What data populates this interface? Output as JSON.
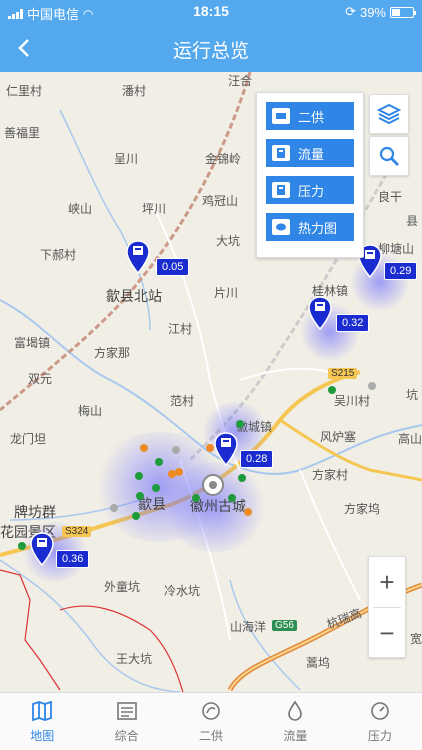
{
  "status": {
    "carrier": "中国电信",
    "time": "18:15",
    "battery": "39%"
  },
  "nav": {
    "title": "运行总览",
    "back": "‹"
  },
  "layers": {
    "items": [
      "二供",
      "流量",
      "压力",
      "热力图"
    ]
  },
  "places": [
    "汪合",
    "仁里村",
    "潘村",
    "善福里",
    "呈川",
    "金锦岭",
    "峡山",
    "坪川",
    "鸡冠山",
    "下郝村",
    "大坑",
    "歙县北站",
    "片川",
    "柳塘山",
    "良干",
    "桂林镇",
    "富堨镇",
    "方家那",
    "江村",
    "双元",
    "范村",
    "梅山",
    "龙门坦",
    "徽城镇",
    "风炉塞",
    "吴川村",
    "高山",
    "方家村",
    "歙县",
    "徽州古城",
    "方家坞",
    "牌坊群",
    "花园景区",
    "外童坑",
    "冷水坑",
    "山海洋",
    "王大坑",
    "蒿坞",
    "坑",
    "宽",
    "县",
    "杭瑞高"
  ],
  "roads": {
    "s215": "S215",
    "s324": "S324",
    "g56": "G56"
  },
  "pins": [
    "0.05",
    "0.29",
    "0.32",
    "0.28",
    "0.36"
  ],
  "zoom": {
    "in": "+",
    "out": "−"
  },
  "tabs": [
    "地图",
    "综合",
    "二供",
    "流量",
    "压力"
  ],
  "colors": {
    "primary": "#54a9ee",
    "active": "#2f86e6",
    "pin": "#1a2bd0"
  }
}
